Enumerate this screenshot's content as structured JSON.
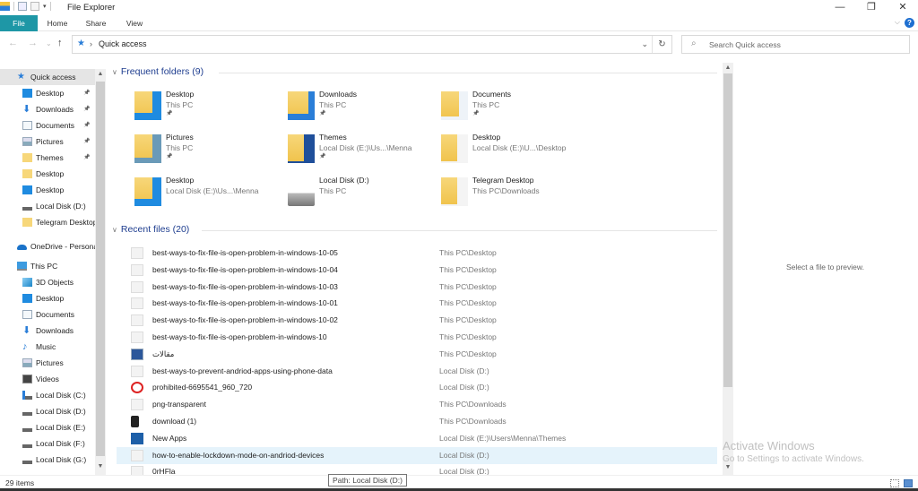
{
  "window": {
    "title": "File Explorer",
    "minimize": "—",
    "restore": "❐",
    "close": "✕"
  },
  "ribbon": {
    "tabs": [
      {
        "label": "File"
      },
      {
        "label": "Home"
      },
      {
        "label": "Share"
      },
      {
        "label": "View"
      }
    ],
    "help": "?",
    "expand": "⌵"
  },
  "nav": {
    "back": "←",
    "forward": "→",
    "recent": "⌄",
    "up": "↑",
    "address": "Quick access",
    "address_sep": "›",
    "dropdown": "⌄",
    "refresh": "↻",
    "search_placeholder": "Search Quick access"
  },
  "sidebar": {
    "items": [
      {
        "label": "Quick access",
        "icon": "star-icon",
        "pinned": false,
        "selected": true,
        "level": 0
      },
      {
        "label": "Desktop",
        "icon": "desktop-icon",
        "pinned": true,
        "level": 1
      },
      {
        "label": "Downloads",
        "icon": "download-icon",
        "pinned": true,
        "level": 1
      },
      {
        "label": "Documents",
        "icon": "documents-icon",
        "pinned": true,
        "level": 1
      },
      {
        "label": "Pictures",
        "icon": "pictures-icon",
        "pinned": true,
        "level": 1
      },
      {
        "label": "Themes",
        "icon": "folder-icon",
        "pinned": true,
        "level": 1
      },
      {
        "label": "Desktop",
        "icon": "folder-icon",
        "pinned": false,
        "level": 1
      },
      {
        "label": "Desktop",
        "icon": "desktop-icon",
        "pinned": false,
        "level": 1
      },
      {
        "label": "Local Disk (D:)",
        "icon": "drive-icon",
        "pinned": false,
        "level": 1
      },
      {
        "label": "Telegram Desktop",
        "icon": "folder-icon",
        "pinned": false,
        "level": 1
      },
      {
        "label": "OneDrive - Personal",
        "icon": "onedrive-icon",
        "pinned": false,
        "level": 0
      },
      {
        "label": "This PC",
        "icon": "pc-icon",
        "pinned": false,
        "level": 0
      },
      {
        "label": "3D Objects",
        "icon": "3d-objects-icon",
        "pinned": false,
        "level": 1
      },
      {
        "label": "Desktop",
        "icon": "desktop-icon",
        "pinned": false,
        "level": 1
      },
      {
        "label": "Documents",
        "icon": "documents-icon",
        "pinned": false,
        "level": 1
      },
      {
        "label": "Downloads",
        "icon": "download-icon",
        "pinned": false,
        "level": 1
      },
      {
        "label": "Music",
        "icon": "music-icon",
        "pinned": false,
        "level": 1
      },
      {
        "label": "Pictures",
        "icon": "pictures-icon",
        "pinned": false,
        "level": 1
      },
      {
        "label": "Videos",
        "icon": "videos-icon",
        "pinned": false,
        "level": 1
      },
      {
        "label": "Local Disk (C:)",
        "icon": "system-drive-icon",
        "pinned": false,
        "level": 1
      },
      {
        "label": "Local Disk (D:)",
        "icon": "drive-icon",
        "pinned": false,
        "level": 1
      },
      {
        "label": "Local Disk (E:)",
        "icon": "drive-icon",
        "pinned": false,
        "level": 1
      },
      {
        "label": "Local Disk (F:)",
        "icon": "drive-icon",
        "pinned": false,
        "level": 1
      },
      {
        "label": "Local Disk (G:)",
        "icon": "drive-icon",
        "pinned": false,
        "level": 1
      }
    ]
  },
  "frequent": {
    "heading": "Frequent folders (9)",
    "folders": [
      {
        "name": "Desktop",
        "sub": "This PC",
        "pinned": true,
        "icon": "desktop-folder-icon"
      },
      {
        "name": "Downloads",
        "sub": "This PC",
        "pinned": true,
        "icon": "downloads-folder-icon"
      },
      {
        "name": "Documents",
        "sub": "This PC",
        "pinned": true,
        "icon": "documents-folder-icon"
      },
      {
        "name": "Pictures",
        "sub": "This PC",
        "pinned": true,
        "icon": "pictures-folder-icon"
      },
      {
        "name": "Themes",
        "sub": "Local Disk (E:)\\Us...\\Menna",
        "pinned": true,
        "icon": "themes-folder-icon"
      },
      {
        "name": "Desktop",
        "sub": "Local Disk (E:)\\U...\\Desktop",
        "pinned": false,
        "icon": "folder-icon"
      },
      {
        "name": "Desktop",
        "sub": "Local Disk (E:)\\Us...\\Menna",
        "pinned": false,
        "icon": "desktop-folder-icon"
      },
      {
        "name": "Local Disk (D:)",
        "sub": "This PC",
        "pinned": false,
        "icon": "drive-icon"
      },
      {
        "name": "Telegram Desktop",
        "sub": "This PC\\Downloads",
        "pinned": false,
        "icon": "folder-icon"
      }
    ]
  },
  "recent": {
    "heading": "Recent files (20)",
    "files": [
      {
        "name": "best-ways-to-fix-file-is-open-problem-in-windows-10-05",
        "location": "This PC\\Desktop",
        "icon": "image-file-icon"
      },
      {
        "name": "best-ways-to-fix-file-is-open-problem-in-windows-10-04",
        "location": "This PC\\Desktop",
        "icon": "image-file-icon"
      },
      {
        "name": "best-ways-to-fix-file-is-open-problem-in-windows-10-03",
        "location": "This PC\\Desktop",
        "icon": "image-file-icon"
      },
      {
        "name": "best-ways-to-fix-file-is-open-problem-in-windows-10-01",
        "location": "This PC\\Desktop",
        "icon": "image-file-icon"
      },
      {
        "name": "best-ways-to-fix-file-is-open-problem-in-windows-10-02",
        "location": "This PC\\Desktop",
        "icon": "image-file-icon"
      },
      {
        "name": "best-ways-to-fix-file-is-open-problem-in-windows-10",
        "location": "This PC\\Desktop",
        "icon": "image-file-icon"
      },
      {
        "name": "مقالات",
        "location": "This PC\\Desktop",
        "icon": "word-file-icon"
      },
      {
        "name": "best-ways-to-prevent-andriod-apps-using-phone-data",
        "location": "Local Disk (D:)",
        "icon": "image-file-icon"
      },
      {
        "name": "prohibited-6695541_960_720",
        "location": "Local Disk (D:)",
        "icon": "prohibited-image-icon"
      },
      {
        "name": "png-transparent",
        "location": "This PC\\Downloads",
        "icon": "image-file-icon"
      },
      {
        "name": "download (1)",
        "location": "This PC\\Downloads",
        "icon": "phone-image-icon"
      },
      {
        "name": "New Apps",
        "location": "Local Disk (E:)\\Users\\Menna\\Themes",
        "icon": "photoshop-file-icon"
      },
      {
        "name": "how-to-enable-lockdown-mode-on-andriod-devices",
        "location": "Local Disk (D:)",
        "icon": "image-file-icon",
        "hover": true
      },
      {
        "name": "0rHFla",
        "location": "Local Disk (D:)",
        "icon": "image-file-icon"
      }
    ]
  },
  "preview": {
    "message": "Select a file to preview."
  },
  "watermark": {
    "line1": "Activate Windows",
    "line2": "Go to Settings to activate Windows."
  },
  "status": {
    "count": "29 items"
  },
  "tooltip": {
    "text": "Path: Local Disk (D:)"
  }
}
